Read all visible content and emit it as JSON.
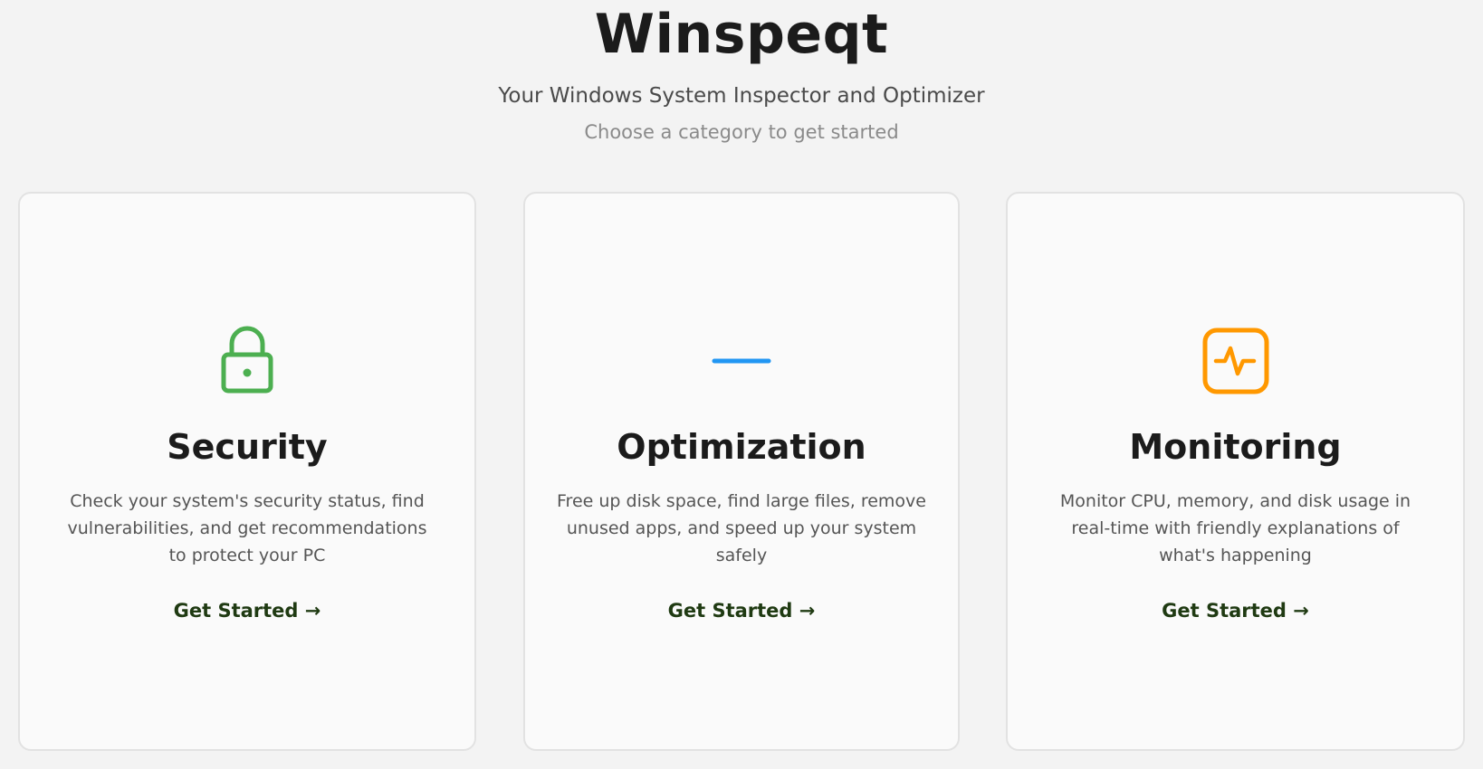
{
  "header": {
    "title": "Winspeqt",
    "subtitle": "Your Windows System Inspector and Optimizer",
    "hint": "Choose a category to get started"
  },
  "cards": [
    {
      "title": "Security",
      "description": "Check your system's security status, find vulnerabilities, and get recommendations to protect your PC",
      "cta": "Get Started →",
      "icon": "lock-icon",
      "color": "#4caf50"
    },
    {
      "title": "Optimization",
      "description": "Free up disk space, find large files, remove unused apps, and speed up your system safely",
      "cta": "Get Started →",
      "icon": "dash-icon",
      "color": "#2196f3"
    },
    {
      "title": "Monitoring",
      "description": "Monitor CPU, memory, and disk usage in real-time with friendly explanations of what's happening",
      "cta": "Get Started →",
      "icon": "activity-icon",
      "color": "#ff9800"
    }
  ]
}
